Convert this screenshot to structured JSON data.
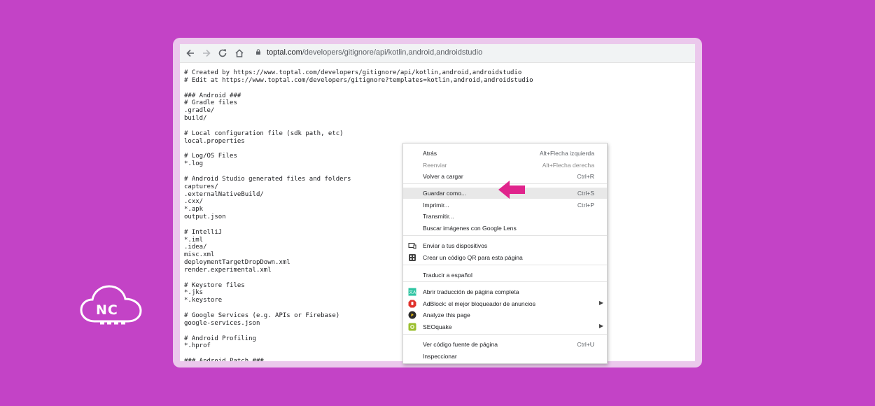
{
  "browser": {
    "url_domain": "toptal.com",
    "url_path": "/developers/gitignore/api/kotlin,android,androidstudio",
    "nav": {
      "back_icon": "arrow-left-icon",
      "forward_icon": "arrow-right-icon",
      "reload_icon": "reload-icon",
      "home_icon": "home-icon",
      "lock_icon": "lock-icon"
    }
  },
  "code_lines": [
    "# Created by https://www.toptal.com/developers/gitignore/api/kotlin,android,androidstudio",
    "# Edit at https://www.toptal.com/developers/gitignore?templates=kotlin,android,androidstudio",
    "",
    "### Android ###",
    "# Gradle files",
    ".gradle/",
    "build/",
    "",
    "# Local configuration file (sdk path, etc)",
    "local.properties",
    "",
    "# Log/OS Files",
    "*.log",
    "",
    "# Android Studio generated files and folders",
    "captures/",
    ".externalNativeBuild/",
    ".cxx/",
    "*.apk",
    "output.json",
    "",
    "# IntelliJ",
    "*.iml",
    ".idea/",
    "misc.xml",
    "deploymentTargetDropDown.xml",
    "render.experimental.xml",
    "",
    "# Keystore files",
    "*.jks",
    "*.keystore",
    "",
    "# Google Services (e.g. APIs or Firebase)",
    "google-services.json",
    "",
    "# Android Profiling",
    "*.hprof",
    "",
    "### Android Patch ###"
  ],
  "context_menu": {
    "items": [
      {
        "label": "Atrás",
        "shortcut": "Alt+Flecha izquierda"
      },
      {
        "label": "Reenviar",
        "shortcut": "Alt+Flecha derecha",
        "disabled": true
      },
      {
        "label": "Volver a cargar",
        "shortcut": "Ctrl+R"
      },
      {
        "label": "Guardar como...",
        "shortcut": "Ctrl+S",
        "highlighted": true
      },
      {
        "label": "Imprimir...",
        "shortcut": "Ctrl+P"
      },
      {
        "label": "Transmitir..."
      },
      {
        "label": "Buscar imágenes con Google Lens"
      },
      {
        "label": "Enviar a tus dispositivos",
        "icon": "devices-icon"
      },
      {
        "label": "Crear un código QR para esta página",
        "icon": "qr-code-icon"
      },
      {
        "label": "Traducir a español"
      },
      {
        "label": "Abrir traducción de página completa",
        "icon": "translate-extension-icon"
      },
      {
        "label": "AdBlock: el mejor bloqueador de anuncios",
        "icon": "adblock-icon",
        "submenu": true
      },
      {
        "label": "Analyze this page",
        "icon": "analyze-extension-icon"
      },
      {
        "label": "SEOquake",
        "icon": "seoquake-icon",
        "submenu": true
      },
      {
        "label": "Ver código fuente de página",
        "shortcut": "Ctrl+U"
      },
      {
        "label": "Inspeccionar"
      }
    ]
  },
  "logo": {
    "text": "NC",
    "icon": "cloud-icon"
  },
  "colors": {
    "background": "#c343c6",
    "frame": "#ebc8ec",
    "arrow": "#e0248c"
  }
}
